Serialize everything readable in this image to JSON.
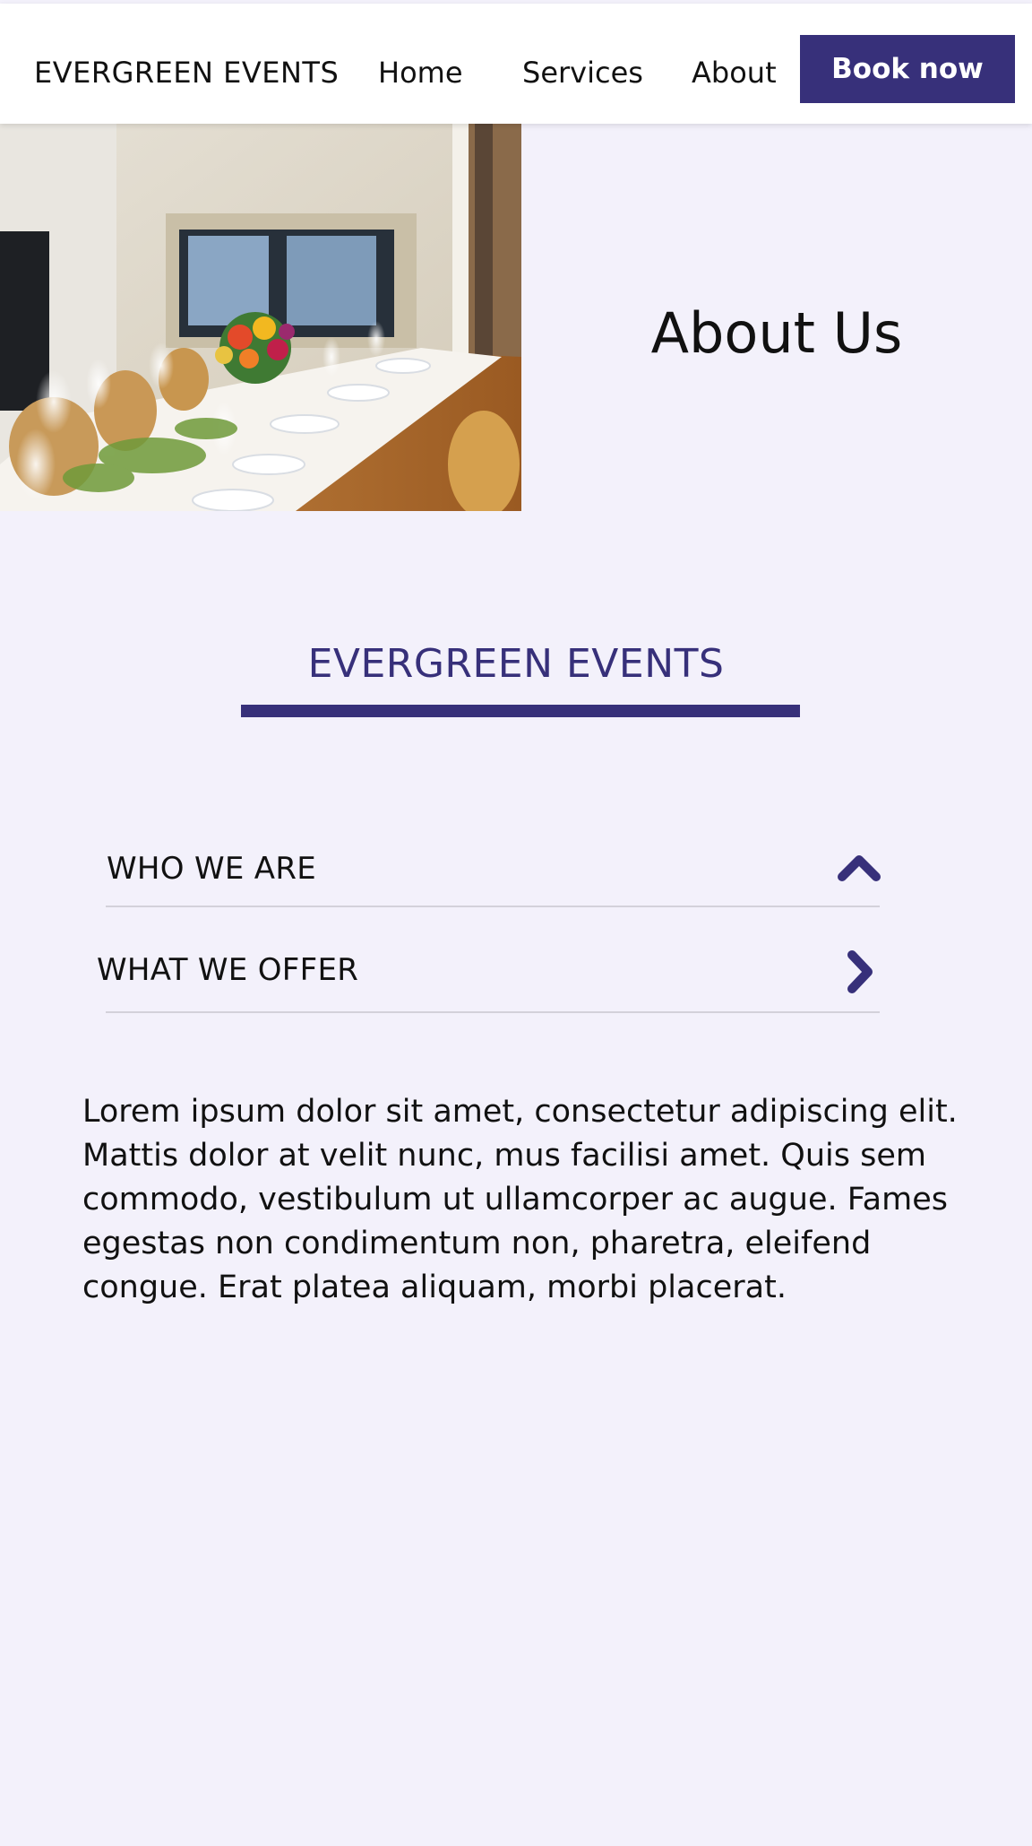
{
  "header": {
    "logo": "EVERGREEN EVENTS",
    "nav": {
      "home": "Home",
      "services": "Services",
      "about": "About"
    },
    "cta": "Book now"
  },
  "hero": {
    "title": "About Us"
  },
  "brand": {
    "heading": "EVERGREEN EVENTS"
  },
  "accordion": {
    "items": [
      {
        "label": "WHO WE ARE",
        "icon": "chevron-up-icon"
      },
      {
        "label": "WHAT WE OFFER",
        "icon": "chevron-right-icon"
      }
    ]
  },
  "content": {
    "paragraph": "Lorem ipsum dolor sit amet, consectetur adipiscing elit. Mattis dolor at velit nunc, mus facilisi amet. Quis sem commodo, vestibulum ut ullamcorper ac augue. Fames egestas non condimentum non, pharetra, eleifend congue. Erat platea aliquam, morbi placerat."
  },
  "colors": {
    "accent": "#37307a",
    "background": "#f3f1fb",
    "header_bg": "#ffffff",
    "divider": "#d3d1da"
  }
}
